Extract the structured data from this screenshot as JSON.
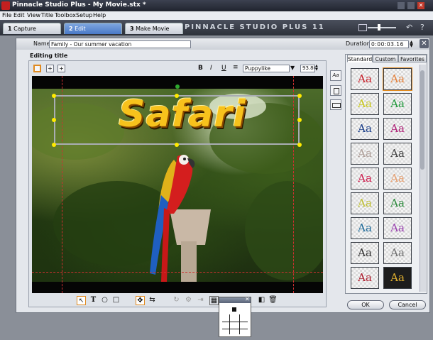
{
  "window": {
    "title": "Pinnacle Studio Plus - My Movie.stx *"
  },
  "menu": [
    "File",
    "Edit",
    "View",
    "Title",
    "Toolbox",
    "Setup",
    "Help"
  ],
  "mode_tabs": [
    {
      "num": "1",
      "label": "Capture"
    },
    {
      "num": "2",
      "label": "Edit"
    },
    {
      "num": "3",
      "label": "Make Movie"
    }
  ],
  "brand": "PINNACLE STUDIO PLUS 11",
  "title_editor": {
    "name_label": "Name:",
    "name_value": "Family - Our summer vacation",
    "duration_label": "Duration:",
    "duration_value": "0:00:03.16",
    "section_label": "Editing title",
    "format": {
      "bold": "B",
      "italic": "I",
      "underline": "U",
      "font": "Puppylike",
      "size": "93.80"
    },
    "title_text": "Safari"
  },
  "looks_panel": {
    "tabs": [
      "Standard",
      "Custom",
      "Favorites"
    ],
    "swatch_text": "Aa",
    "swatch_colors": [
      "#c8202a",
      "#e5803a",
      "#c9c81a",
      "#1f9a3a",
      "#1a3e8a",
      "#b02078",
      "#b0a09a",
      "#444444",
      "#d02050",
      "#e8a070",
      "#c0c030",
      "#2a8a3a",
      "#1c6a9a",
      "#9a40b0",
      "#333333",
      "#707070",
      "#b02030",
      "#e0b030"
    ]
  },
  "buttons": {
    "ok": "OK",
    "cancel": "Cancel"
  }
}
